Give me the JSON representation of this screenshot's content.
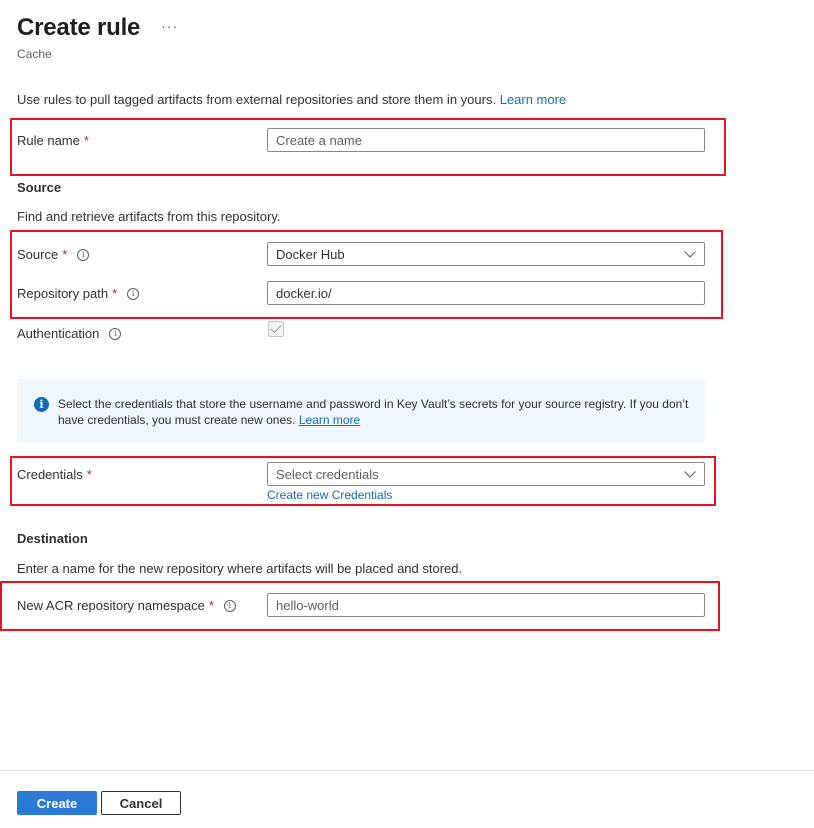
{
  "header": {
    "title": "Create rule",
    "more_label": "···",
    "subtitle": "Cache"
  },
  "intro": {
    "text": "Use rules to pull tagged artifacts from external repositories and store them in yours.",
    "learn_more": "Learn more"
  },
  "rule_name": {
    "label": "Rule name",
    "required": "*",
    "placeholder": "Create a name",
    "value": ""
  },
  "source_section": {
    "heading": "Source",
    "description": "Find and retrieve artifacts from this repository.",
    "source": {
      "label": "Source",
      "required": "*",
      "info_icon": "info-icon",
      "selected": "Docker Hub"
    },
    "repository_path": {
      "label": "Repository path",
      "required": "*",
      "info_icon": "info-icon",
      "value": "docker.io/"
    },
    "authentication": {
      "label": "Authentication",
      "info_icon": "info-icon",
      "checked": true,
      "disabled": true
    }
  },
  "info_banner": {
    "icon": "info-filled-icon",
    "text": "Select the credentials that store the username and password in Key Vault’s secrets for your source registry. If you don’t have credentials, you must create new ones.",
    "learn_more": "Learn more"
  },
  "credentials": {
    "label": "Credentials",
    "required": "*",
    "placeholder": "Select credentials",
    "create_link": "Create new Credentials"
  },
  "destination_section": {
    "heading": "Destination",
    "description": "Enter a name for the new repository where artifacts will be placed and stored.",
    "namespace": {
      "label": "New ACR repository namespace",
      "required": "*",
      "info_icon": "info-icon",
      "placeholder": "hello-world",
      "value": ""
    }
  },
  "footer": {
    "create_label": "Create",
    "cancel_label": "Cancel"
  },
  "colors": {
    "highlight": "#e81123",
    "primary": "#2b7bd6",
    "link": "#0f6cbd",
    "required": "#a4262c",
    "info_banner_bg": "#eff6fc"
  }
}
